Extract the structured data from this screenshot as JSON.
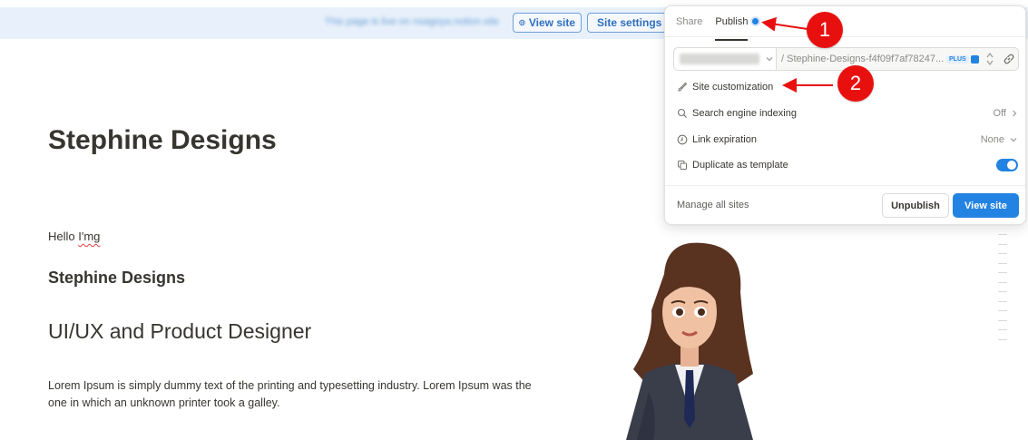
{
  "banner": {
    "text": "This page is live on nsagoya.notion.site",
    "view_site_label": "View site",
    "site_settings_label": "Site settings"
  },
  "page": {
    "title": "Stephine Designs",
    "hello_prefix": "Hello ",
    "hello_word": "I'mg",
    "heading3": "Stephine Designs",
    "heading2": "UI/UX and Product Designer",
    "paragraph": "Lorem Ipsum is simply dummy text of the printing and typesetting industry. Lorem Ipsum was the one in which an unknown printer took a galley."
  },
  "popover": {
    "tabs": [
      {
        "label": "Share",
        "active": false
      },
      {
        "label": "Publish",
        "active": true
      }
    ],
    "url": {
      "slug": "/ Stephine-Designs-f4f09f7af78247...",
      "plan_badge": "PLUS"
    },
    "options": [
      {
        "label": "Site customization",
        "icon": "brush-icon",
        "value": ""
      },
      {
        "label": "Search engine indexing",
        "icon": "search-icon",
        "value": "Off"
      },
      {
        "label": "Link expiration",
        "icon": "clock-icon",
        "value": "None"
      },
      {
        "label": "Duplicate as template",
        "icon": "duplicate-icon",
        "value": "",
        "toggle_on": true
      }
    ],
    "footer": {
      "manage_label": "Manage all sites",
      "unpublish_label": "Unpublish",
      "view_site_label": "View site"
    }
  },
  "callouts": [
    {
      "number": "1"
    },
    {
      "number": "2"
    }
  ],
  "colors": {
    "accent": "#2383e2",
    "callout": "#e8100f",
    "banner_bg": "#e8f1fb"
  }
}
